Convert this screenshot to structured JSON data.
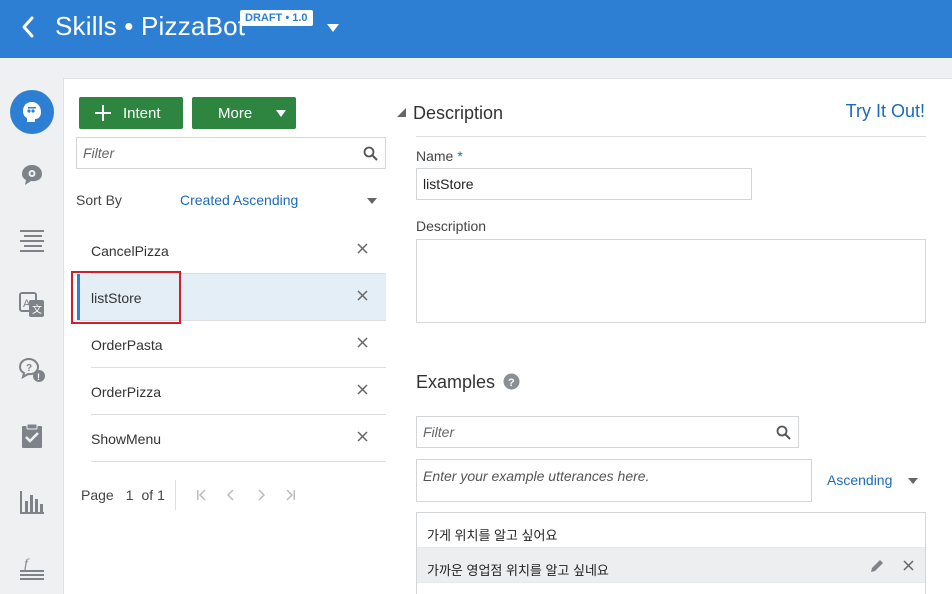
{
  "header": {
    "title": "Skills • PizzaBot",
    "badge": "DRAFT • 1.0",
    "icons": {
      "back": "chevron-left-icon",
      "version_menu": "caret-down-icon"
    }
  },
  "rail": {
    "items": [
      {
        "name": "intents",
        "icon": "robot-head-icon",
        "active": true
      },
      {
        "name": "entities",
        "icon": "chat-gear-icon"
      },
      {
        "name": "flows",
        "icon": "text-lines-icon"
      },
      {
        "name": "resource-bundles",
        "icon": "translate-icon"
      },
      {
        "name": "qna",
        "icon": "question-bubble-icon"
      },
      {
        "name": "quality",
        "icon": "clipboard-check-icon"
      },
      {
        "name": "insights",
        "icon": "bar-chart-icon"
      },
      {
        "name": "components",
        "icon": "function-icon"
      }
    ]
  },
  "toolbar": {
    "intent_label": "Intent",
    "more_label": "More"
  },
  "left": {
    "filter_placeholder": "Filter",
    "sort_label": "Sort By",
    "sort_value": "Created Ascending",
    "intents": [
      {
        "label": "CancelPizza"
      },
      {
        "label": "listStore",
        "selected": true
      },
      {
        "label": "OrderPasta"
      },
      {
        "label": "OrderPizza"
      },
      {
        "label": "ShowMenu"
      }
    ],
    "pager": {
      "page_label": "Page",
      "current": "1",
      "of_label": "of 1"
    }
  },
  "form": {
    "section_title": "Description",
    "try_label": "Try It Out!",
    "name_label": "Name",
    "required_mark": "*",
    "name_value": "listStore",
    "description_label": "Description",
    "description_value": "",
    "examples_title": "Examples",
    "examples_filter_placeholder": "Filter",
    "utterance_placeholder": "Enter your example utterances here.",
    "examples_sort": "Ascending",
    "examples": [
      "가게 위치를 알고 싶어요",
      "가까운 영업점 위치를 알고 싶네요"
    ]
  },
  "colors": {
    "header": "#2d7fd4",
    "primary_button": "#2e8540",
    "link": "#1c6bb8",
    "selection_bg": "#e4eef7",
    "highlight_border": "#d0202a"
  }
}
